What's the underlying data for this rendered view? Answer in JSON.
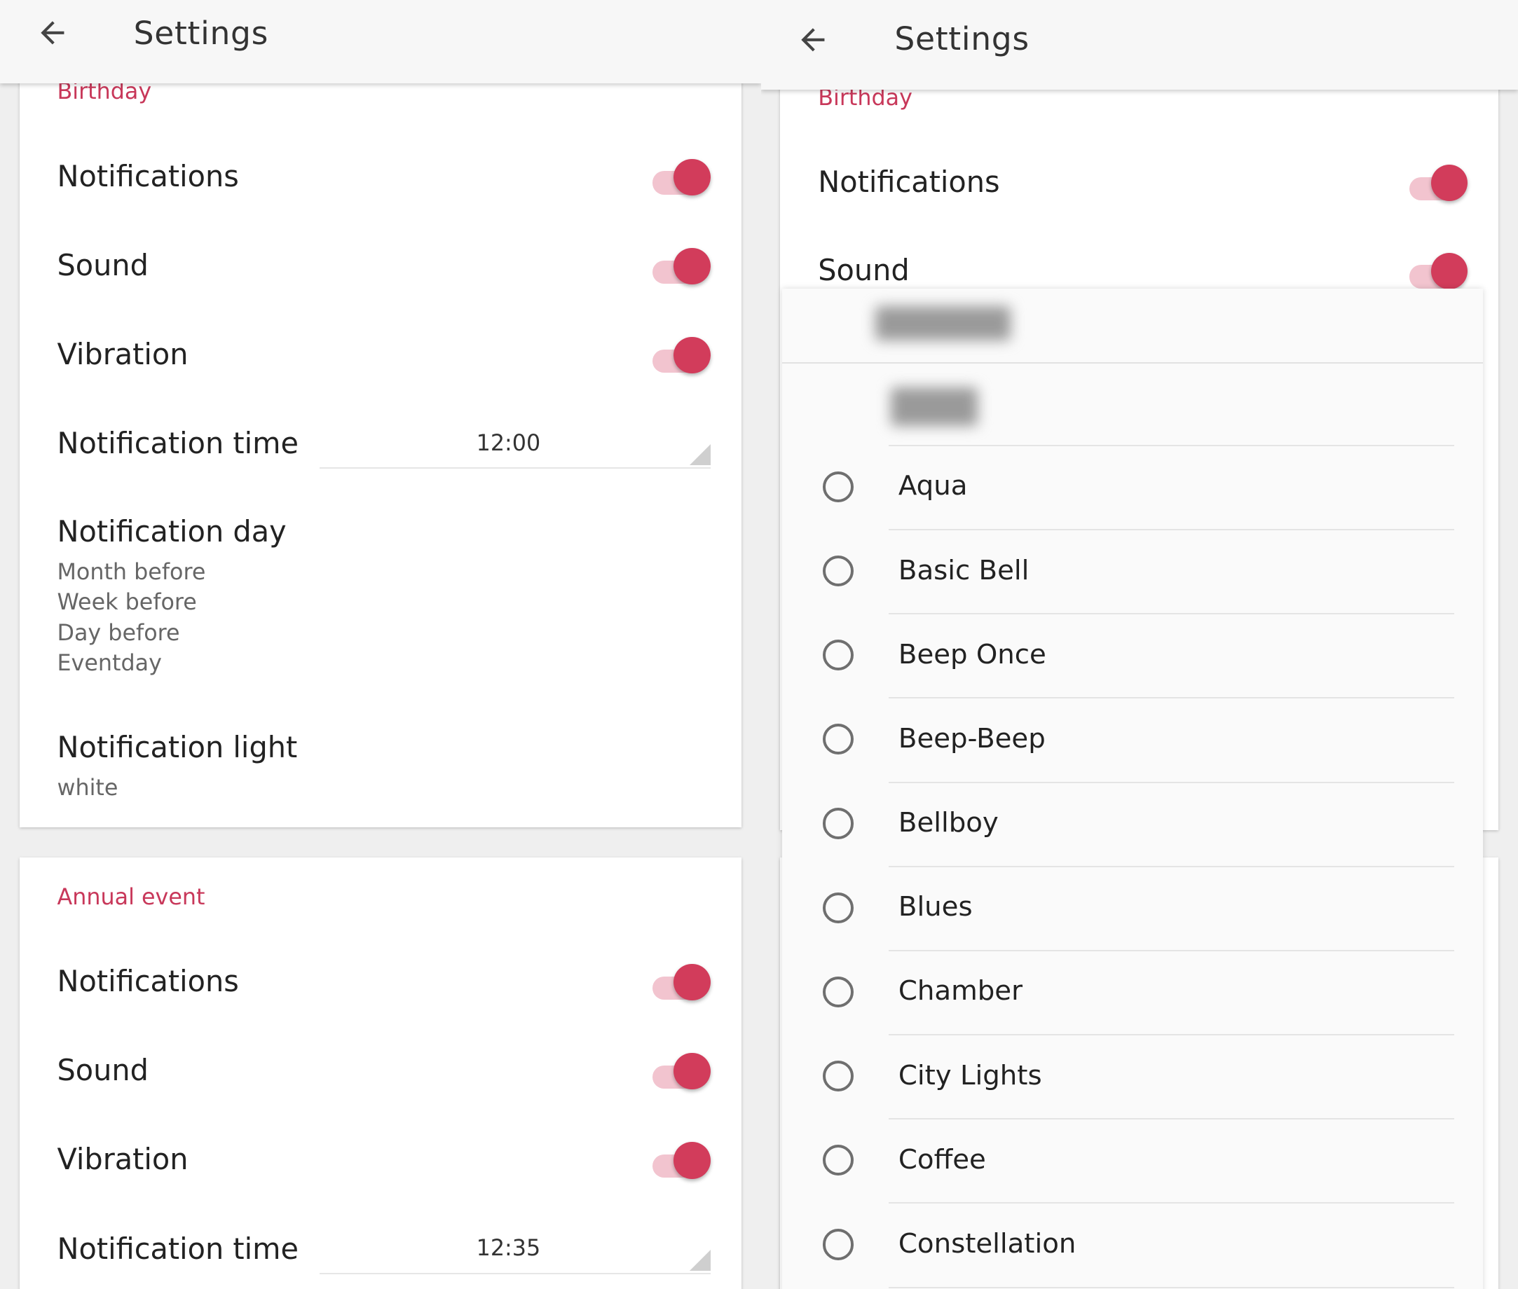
{
  "left": {
    "title": "Settings",
    "birthday": {
      "section": "Birthday",
      "notifications": "Notifications",
      "sound": "Sound",
      "vibration": "Vibration",
      "notification_time": "Notification time",
      "time_value": "12:00",
      "notification_day": "Notification day",
      "day_options": [
        "Month before",
        "Week before",
        "Day before",
        "Eventday"
      ],
      "notification_light": "Notification light",
      "light_value": "white"
    },
    "annual": {
      "section": "Annual event",
      "notifications": "Notifications",
      "sound": "Sound",
      "vibration": "Vibration",
      "notification_time": "Notification time",
      "time_value": "12:35"
    }
  },
  "right": {
    "title": "Settings",
    "section": "Birthday",
    "notifications": "Notifications",
    "sound": "Sound",
    "ringtones": [
      "Aqua",
      "Basic Bell",
      "Beep Once",
      "Beep-Beep",
      "Bellboy",
      "Blues",
      "Chamber",
      "City Lights",
      "Coffee",
      "Constellation"
    ]
  },
  "colors": {
    "accent": "#d23c5b",
    "section_text": "#c8385a",
    "toggle_track": "#f2c4cf"
  }
}
